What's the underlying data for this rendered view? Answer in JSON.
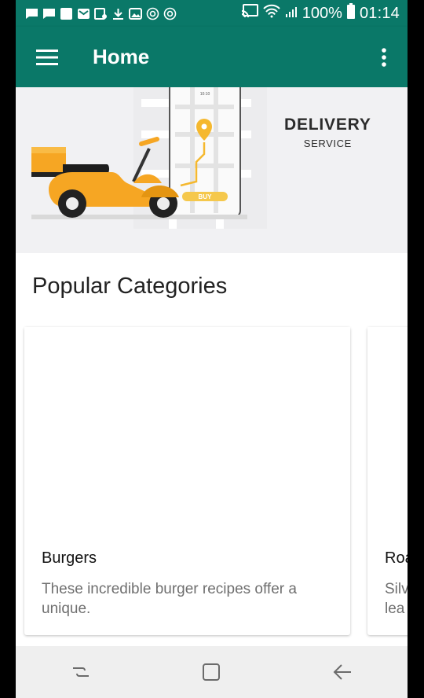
{
  "status_bar": {
    "battery": "100%",
    "time": "01:14"
  },
  "app_bar": {
    "title": "Home",
    "menu_icon": "hamburger-menu-icon",
    "overflow_icon": "more-vert-icon"
  },
  "banner": {
    "headline": "DELIVERY",
    "subheadline": "SERVICE",
    "button_text": "BUY",
    "phone_time": "10:10"
  },
  "main": {
    "section_title": "Popular Categories",
    "categories": [
      {
        "title": "Burgers",
        "description": "These incredible burger recipes offer a unique."
      },
      {
        "title": "Roa",
        "description": "Silv lea"
      }
    ]
  },
  "colors": {
    "primary": "#0a7868",
    "accent": "#f5a623"
  },
  "nav_bar": {
    "recents_icon": "recents-icon",
    "home_icon": "home-square-icon",
    "back_icon": "back-arrow-icon"
  }
}
